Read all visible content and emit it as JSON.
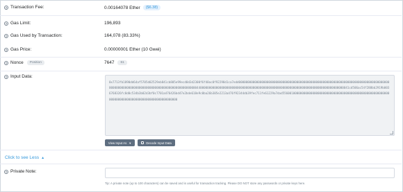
{
  "fee": {
    "label": "Transaction Fee:",
    "value": "0.00164078 Ether",
    "usd": "($6.38)"
  },
  "gas_limit": {
    "label": "Gas Limit:",
    "value": "196,893"
  },
  "gas_used": {
    "label": "Gas Used by Transaction:",
    "value": "164,078 (83.33%)"
  },
  "gas_price": {
    "label": "Gas Price:",
    "value": "0.00000001 Ether (10 Gwei)"
  },
  "nonce": {
    "label": "Nonce",
    "position_badge": "Position",
    "value": "7647",
    "position_value": "61"
  },
  "input_data": {
    "label": "Input Data:",
    "text": "0x7713fb1890dd64af5705d02529eb841cb805e99ecd0d3d2300f6f40ac0f92298d1ca7edd0000000000000000000000000000000000000000000000000000000000000000000000000000000000000000000000000000000000000000000000000000000000000000440000000000000000000000000000000000000000000000000000000000000000000000000000000000041cd506ac54f288bb2919b0036768326fc8d0c534b3b02d3bf0c7701a476426bd47e2bde618e9c0ba26b305e2213a476f92344db39fec711fe61229a7dad5560010000000000000000000000000000000000000000000000000000000000000000000000000000000000000000000000",
    "view_button": "View Input As",
    "decode_button": "Decode Input Data"
  },
  "see_less": {
    "label": "Click to see Less",
    "chevron": "chevron-up-icon"
  },
  "private_note": {
    "label": "Private Note:",
    "placeholder": "",
    "tip": "Tip: A private note (up to 100 characters) can be saved and is useful for transaction tracking. Please DO NOT store any passwords or private keys here."
  },
  "colors": {
    "link": "#3498db",
    "badge_bg": "#e5f1fd",
    "button_bg": "#5e6e80",
    "textarea_bg": "#f0f2f4",
    "divider": "#e7eaf3"
  }
}
